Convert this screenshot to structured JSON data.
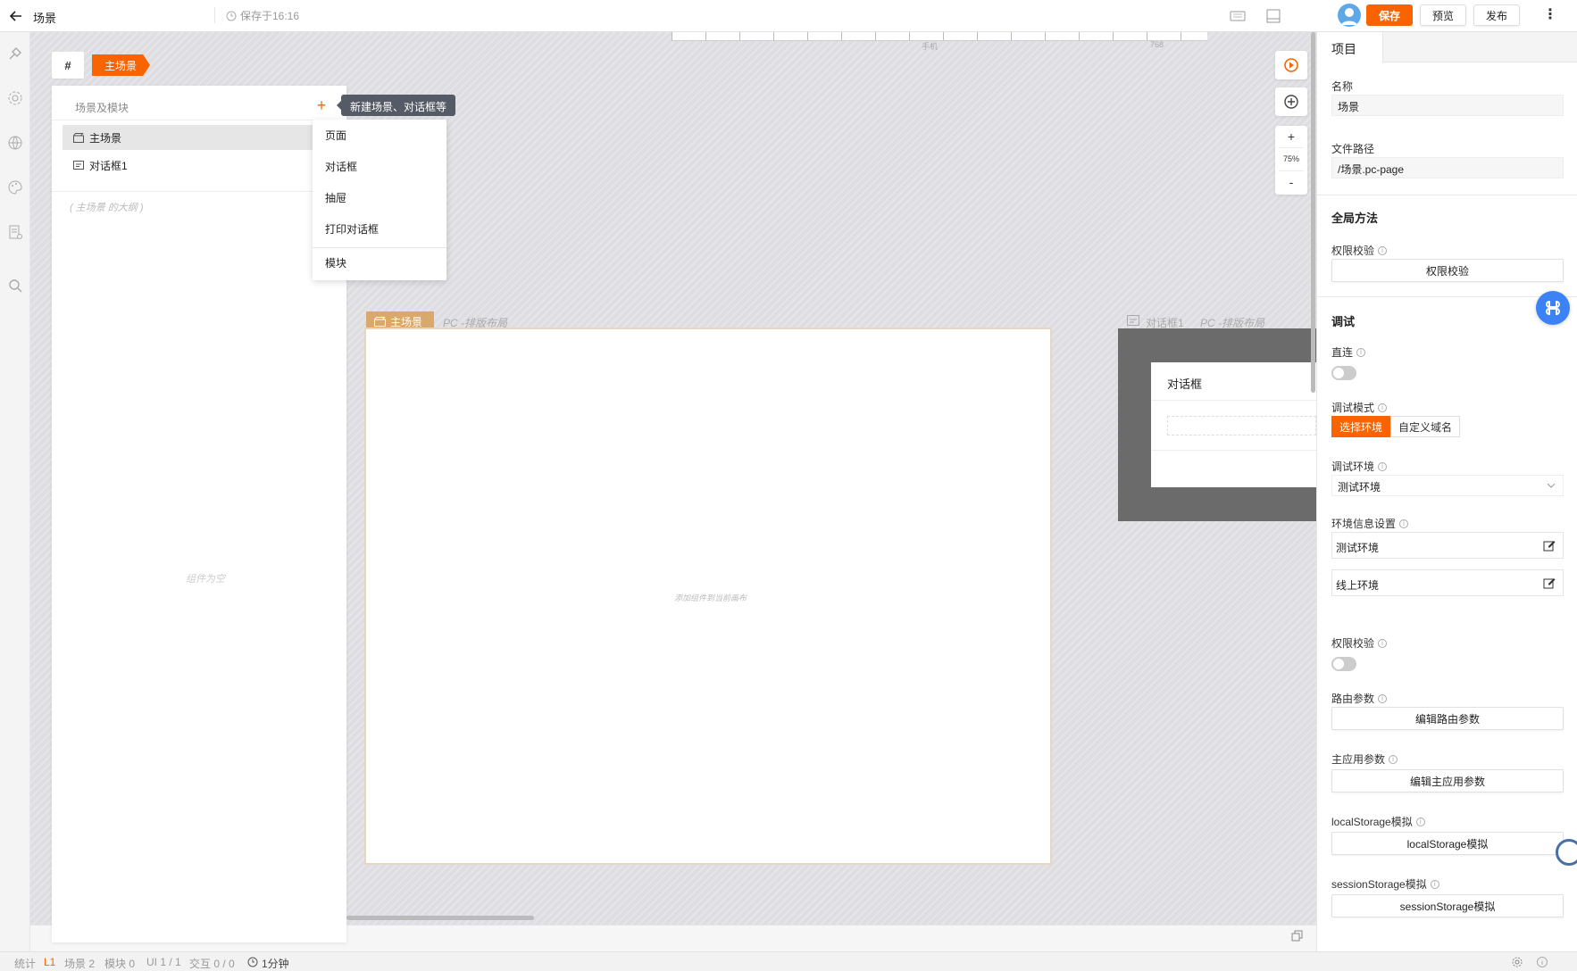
{
  "topbar": {
    "title": "场景",
    "save_status": "保存于16:16",
    "buttons": {
      "save": "保存",
      "preview": "预览",
      "publish": "发布"
    }
  },
  "canvas": {
    "ruler_labels": [
      "手机",
      "768"
    ],
    "scene_tag": "主场景",
    "hash_label": "#",
    "main_frame": {
      "tag": "主场景",
      "layout": "PC -排版布局",
      "hint": "添加组件到当前画布"
    },
    "dialog_frame": {
      "tag": "对话框1",
      "layout": "PC -排版布局",
      "title": "对话框"
    },
    "zoom": {
      "plus": "+",
      "level": "75%",
      "minus": "-"
    }
  },
  "scenes_panel": {
    "header": "场景及模块",
    "add_label": "+",
    "items": [
      {
        "label": "主场景",
        "icon": "clapperboard-icon"
      },
      {
        "label": "对话框1",
        "icon": "dialog-icon"
      }
    ],
    "outline": "( 主场景 的大纲 )",
    "empty": "组件为空",
    "tooltip": "新建场景、对话框等",
    "dropdown": [
      "页面",
      "对话框",
      "抽屉",
      "打印对话框",
      "模块"
    ]
  },
  "right_panel": {
    "tab": "项目",
    "name_label": "名称",
    "name_value": "场景",
    "path_label": "文件路径",
    "path_value": "/场景.pc-page",
    "global_section": "全局方法",
    "auth_label": "权限校验",
    "auth_button": "权限校验",
    "debug_section": "调试",
    "direct_label": "直连",
    "debug_mode_label": "调试模式",
    "debug_mode_options": [
      "选择环境",
      "自定义域名"
    ],
    "debug_env_label": "调试环境",
    "debug_env_value": "测试环境",
    "env_info_label": "环境信息设置",
    "env_rows": [
      "测试环境",
      "线上环境"
    ],
    "auth2_label": "权限校验",
    "route_label": "路由参数",
    "route_button": "编辑路由参数",
    "main_app_label": "主应用参数",
    "main_app_button": "编辑主应用参数",
    "local_label": "localStorage模拟",
    "local_button": "localStorage模拟",
    "session_label": "sessionStorage模拟",
    "session_button": "sessionStorage模拟"
  },
  "statusbar": {
    "stats": "统计",
    "level": "L1",
    "scenes": "场景 2",
    "modules": "模块 0",
    "ui": "UI 1 / 1",
    "interact": "交互 0 / 0",
    "time": "1分钟"
  },
  "colors": {
    "accent": "#fa6400",
    "frame_tag": "#d9a86c"
  }
}
